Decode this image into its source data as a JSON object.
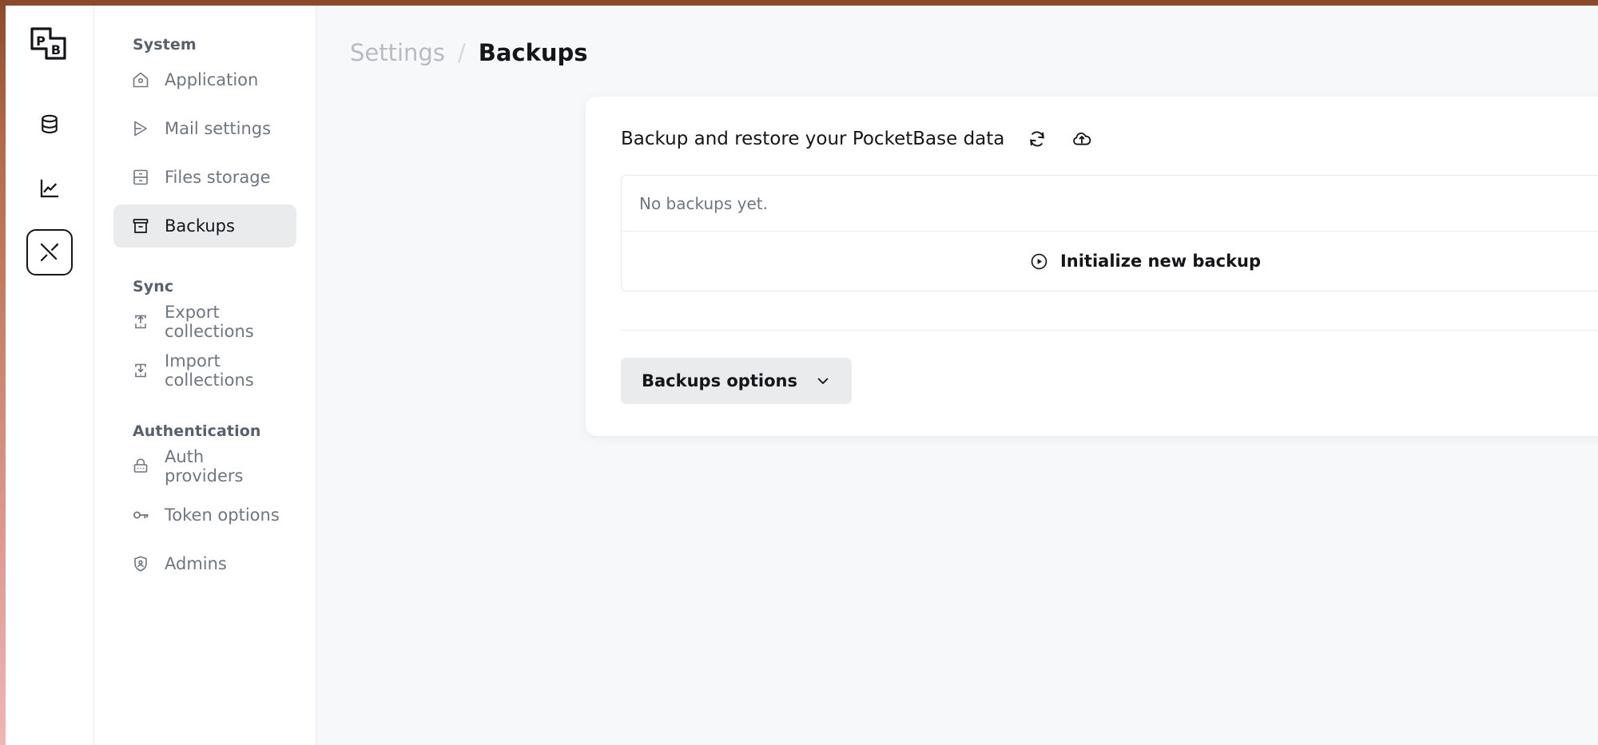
{
  "theme": {
    "accent_bar": "#8a4a2b",
    "active_nav_bg": "#e9ebed",
    "text_primary": "#16161a",
    "text_muted": "#6e767f",
    "page_bg": "#f7f8f9",
    "card_bg": "#ffffff"
  },
  "rail": {
    "logo_label": "PB",
    "items": [
      {
        "name": "collections-icon",
        "title": "Collections"
      },
      {
        "name": "logs-chart-icon",
        "title": "Logs"
      },
      {
        "name": "settings-tools-icon",
        "title": "Settings",
        "active": true
      }
    ]
  },
  "sidebar": {
    "groups": [
      {
        "title": "System",
        "items": [
          {
            "label": "Application",
            "icon": "house-gear-icon",
            "active": false
          },
          {
            "label": "Mail settings",
            "icon": "send-triangle-icon",
            "active": false
          },
          {
            "label": "Files storage",
            "icon": "drawer-icon",
            "active": false
          },
          {
            "label": "Backups",
            "icon": "archive-box-icon",
            "active": true
          }
        ]
      },
      {
        "title": "Sync",
        "items": [
          {
            "label": "Export collections",
            "icon": "export-up-icon",
            "active": false
          },
          {
            "label": "Import collections",
            "icon": "import-down-icon",
            "active": false
          }
        ]
      },
      {
        "title": "Authentication",
        "items": [
          {
            "label": "Auth providers",
            "icon": "lock-icon",
            "active": false
          },
          {
            "label": "Token options",
            "icon": "key-icon",
            "active": false
          },
          {
            "label": "Admins",
            "icon": "shield-user-icon",
            "active": false
          }
        ]
      }
    ]
  },
  "breadcrumb": {
    "parent": "Settings",
    "separator": "/",
    "current": "Backups"
  },
  "panel": {
    "title": "Backup and restore your PocketBase data",
    "refresh_icon": "refresh-icon",
    "upload_icon": "upload-cloud-icon",
    "empty_text": "No backups yet.",
    "init_button_label": "Initialize new backup",
    "init_button_icon": "play-circle-icon",
    "options_button_label": "Backups options",
    "options_button_icon": "chevron-down-icon"
  }
}
